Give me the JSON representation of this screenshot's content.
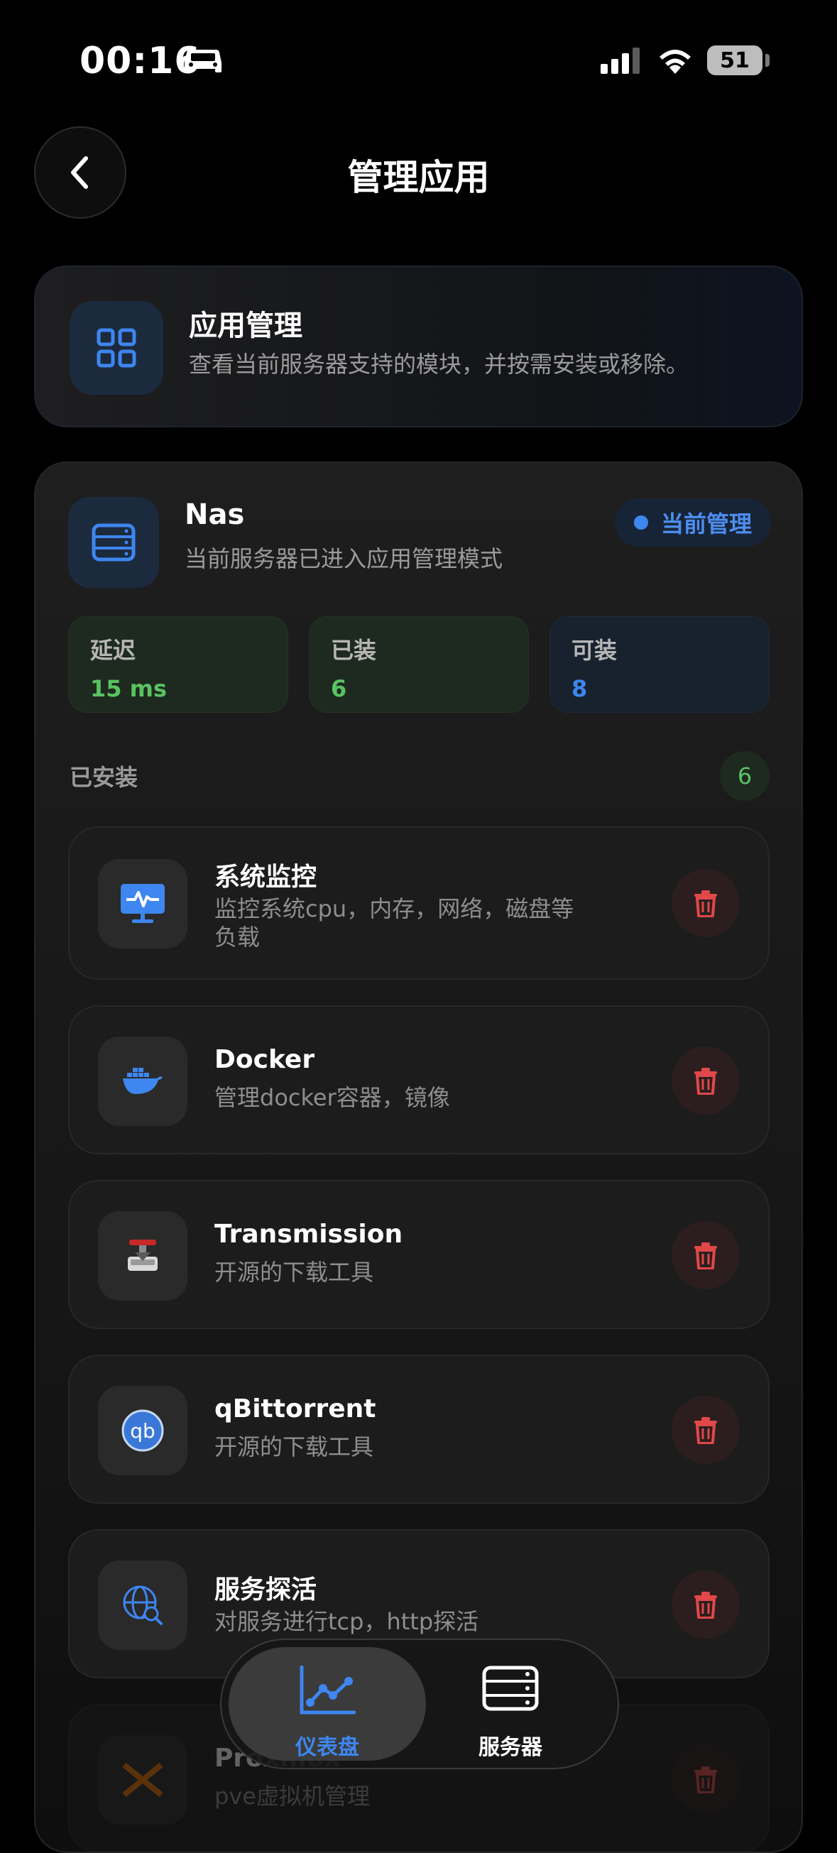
{
  "status_bar": {
    "time": "00:16",
    "battery": "51"
  },
  "header": {
    "title": "管理应用"
  },
  "info_card": {
    "title": "应用管理",
    "description": "查看当前服务器支持的模块，并按需安装或移除。"
  },
  "server": {
    "name": "Nas",
    "description": "当前服务器已进入应用管理模式",
    "badge": "当前管理",
    "stats": [
      {
        "label": "延迟",
        "value": "15 ms"
      },
      {
        "label": "已装",
        "value": "6"
      },
      {
        "label": "可装",
        "value": "8"
      }
    ],
    "installed_label": "已安装",
    "installed_count": "6",
    "apps": [
      {
        "name": "系统监控",
        "description": "监控系统cpu，内存，网络，磁盘等负载",
        "icon": "monitor-icon"
      },
      {
        "name": "Docker",
        "description": "管理docker容器，镜像",
        "icon": "docker-icon"
      },
      {
        "name": "Transmission",
        "description": "开源的下载工具",
        "icon": "transmission-icon"
      },
      {
        "name": "qBittorrent",
        "description": "开源的下载工具",
        "icon": "qbittorrent-icon"
      },
      {
        "name": "服务探活",
        "description": "对服务进行tcp，http探活",
        "icon": "globe-search-icon"
      },
      {
        "name": "Proxmox",
        "description": "pve虚拟机管理",
        "icon": "proxmox-icon"
      }
    ]
  },
  "tab_bar": {
    "tabs": [
      {
        "label": "仪表盘",
        "icon": "chart-icon",
        "active": true
      },
      {
        "label": "服务器",
        "icon": "server-icon",
        "active": false
      }
    ]
  },
  "colors": {
    "accent_blue": "#3e86f0",
    "green": "#59c362",
    "delete_red": "#e0484a"
  }
}
